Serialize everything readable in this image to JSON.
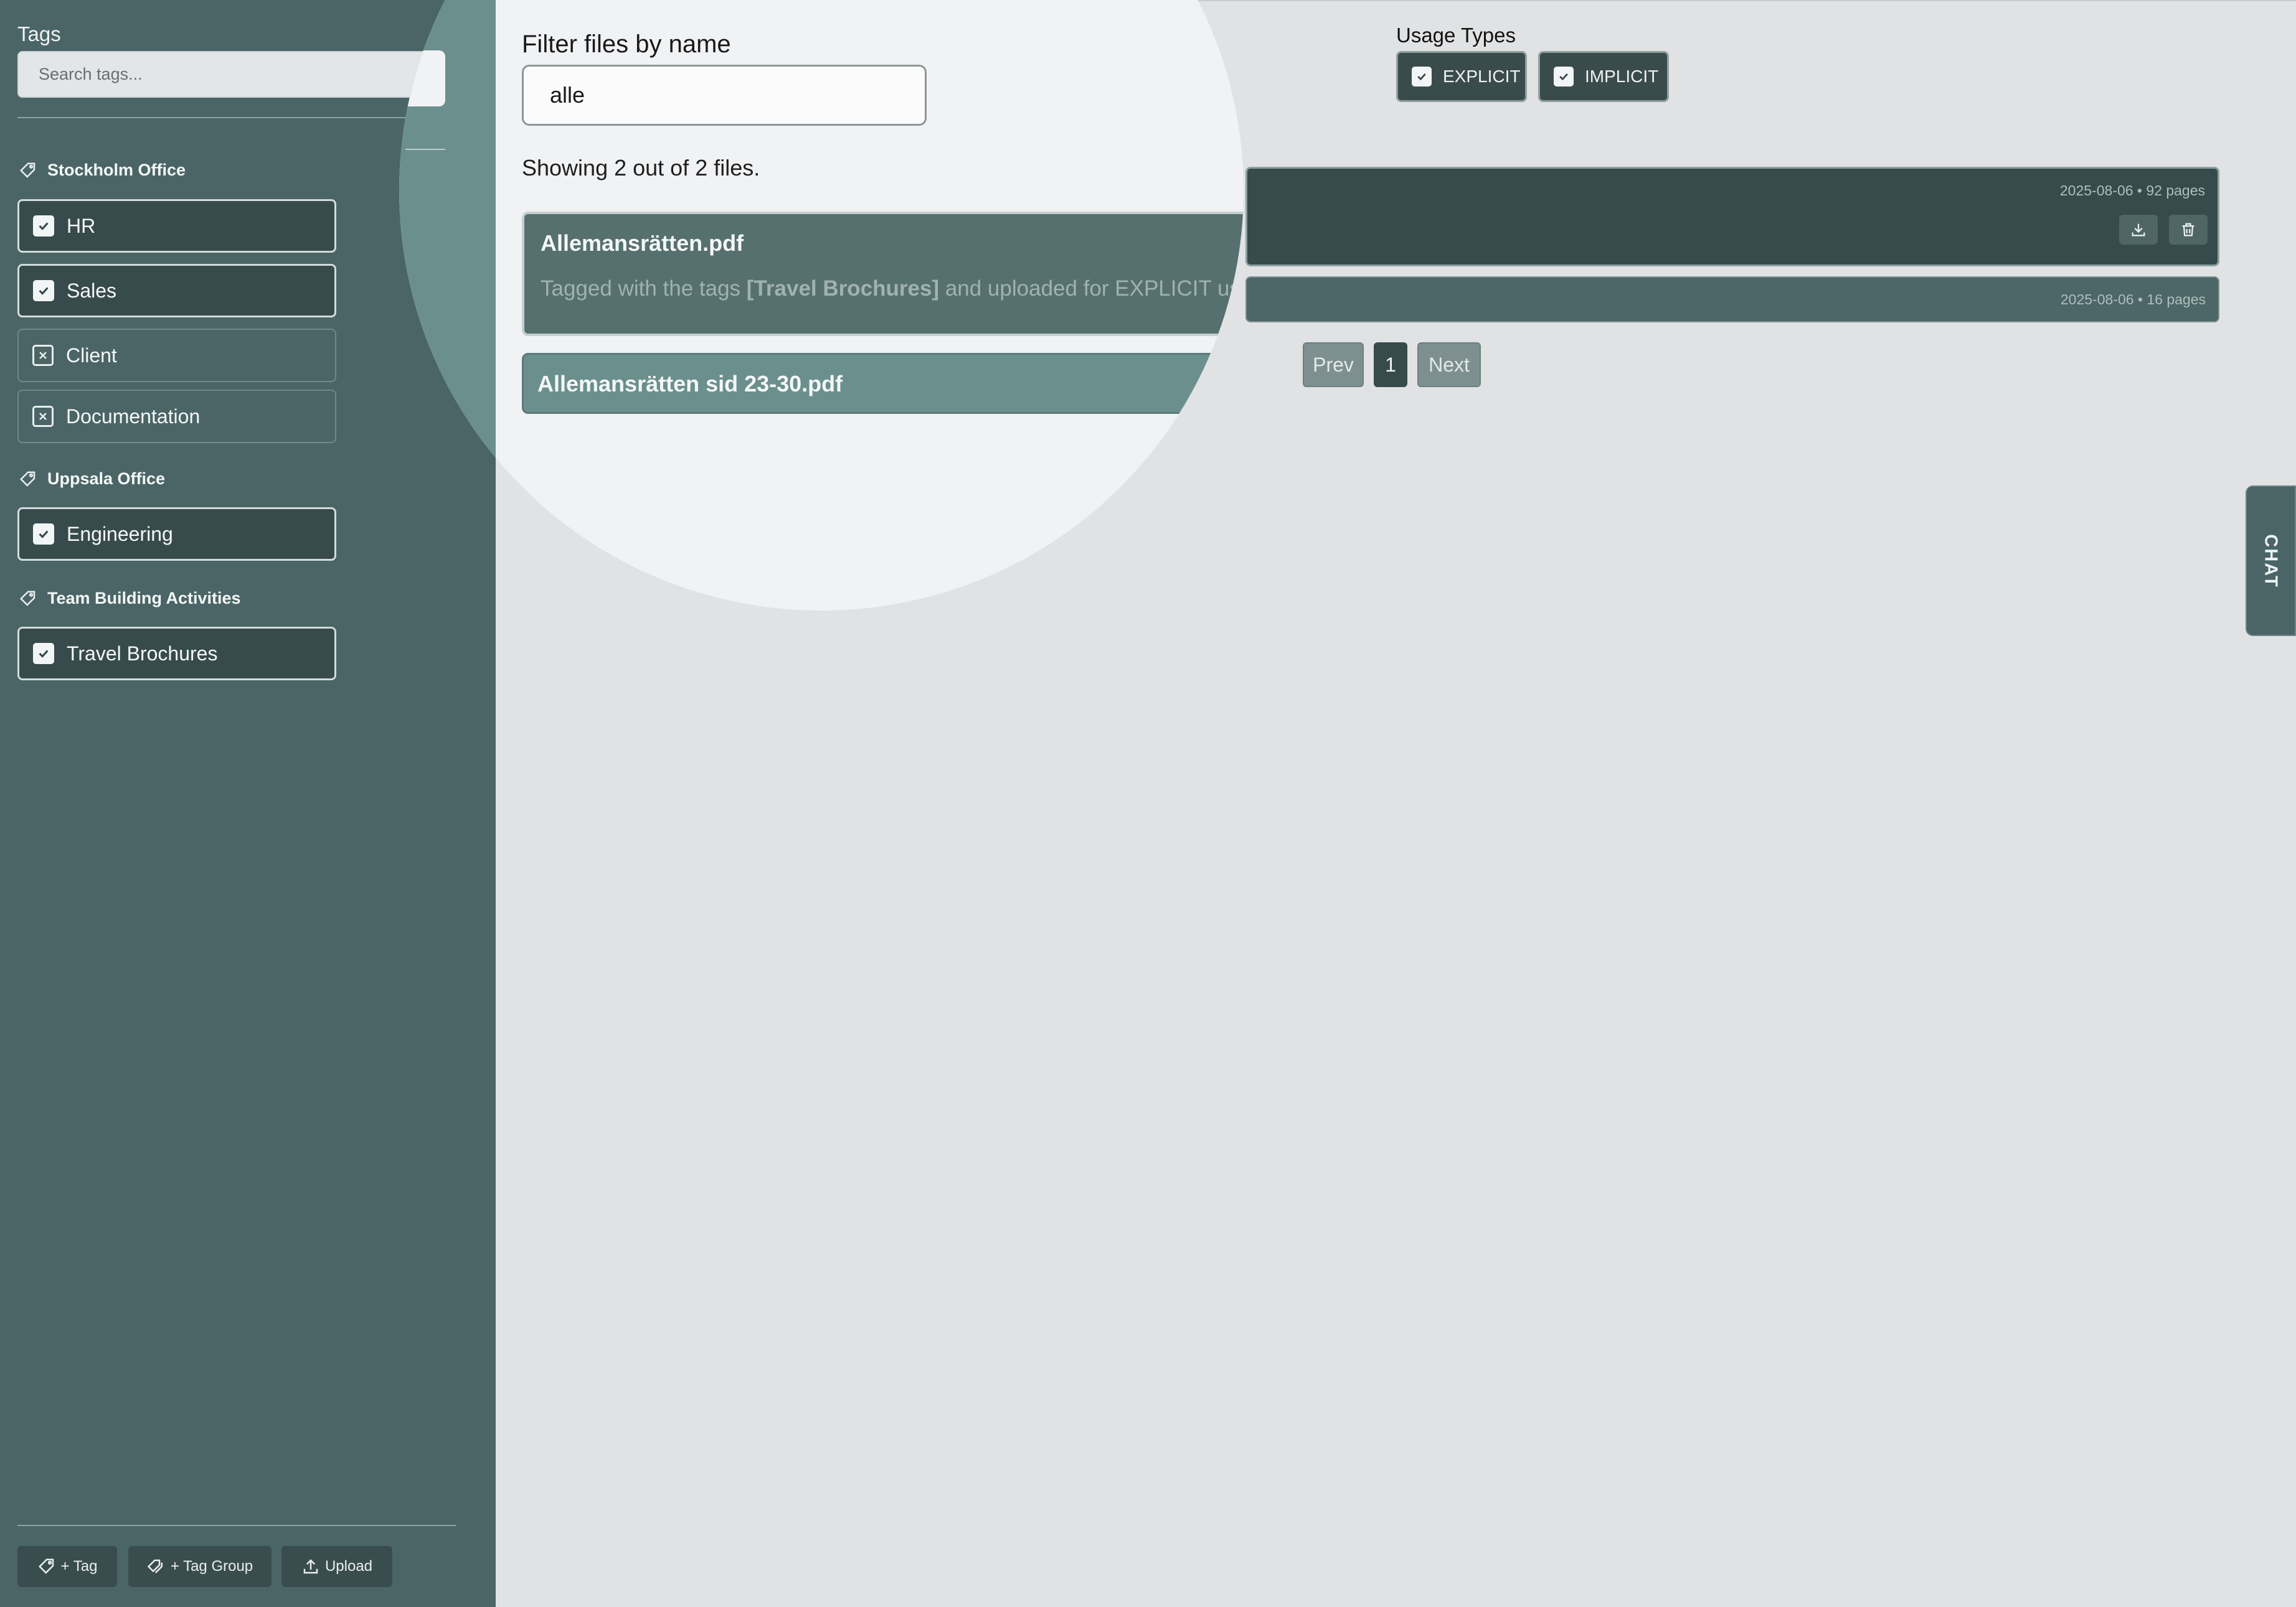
{
  "sidebar": {
    "title": "Tags",
    "search_placeholder": "Search tags...",
    "groups": [
      {
        "name": "Stockholm Office",
        "tags": [
          {
            "label": "HR",
            "checked": true
          },
          {
            "label": "Sales",
            "checked": true
          },
          {
            "label": "Client",
            "checked": false
          },
          {
            "label": "Documentation",
            "checked": false
          }
        ]
      },
      {
        "name": "Uppsala Office",
        "tags": [
          {
            "label": "Engineering",
            "checked": true
          }
        ]
      },
      {
        "name": "Team Building Activities",
        "tags": [
          {
            "label": "Travel Brochures",
            "checked": true
          }
        ]
      }
    ],
    "footer": {
      "add_tag": "+ Tag",
      "add_tag_group": "+ Tag Group",
      "upload": "Upload"
    }
  },
  "filter": {
    "title": "Filter files by name",
    "value": "alle",
    "count_text": "Showing 2 out of 2 files."
  },
  "usage_types": {
    "title": "Usage Types",
    "options": [
      {
        "label": "EXPLICIT",
        "checked": true
      },
      {
        "label": "IMPLICIT",
        "checked": true
      }
    ]
  },
  "files": [
    {
      "name": "Allemansrätten.pdf",
      "meta": "2025-08-06 • 92 pages",
      "desc_prefix": "Tagged with the tags",
      "desc_tags": "[Travel Brochures]",
      "desc_suffix": "and uploaded for EXPLICIT us"
    },
    {
      "name": "Allemansrätten sid 23-30.pdf",
      "meta": "2025-08-06 • 16 pages"
    }
  ],
  "pagination": {
    "prev": "Prev",
    "current": "1",
    "next": "Next"
  },
  "chat_label": "CHAT",
  "colors": {
    "sidebar_bg": "#4b6566",
    "main_bg": "#e1e2e4",
    "selected_bg": "#384b4c",
    "lens_bg": "#f1f2f4"
  }
}
